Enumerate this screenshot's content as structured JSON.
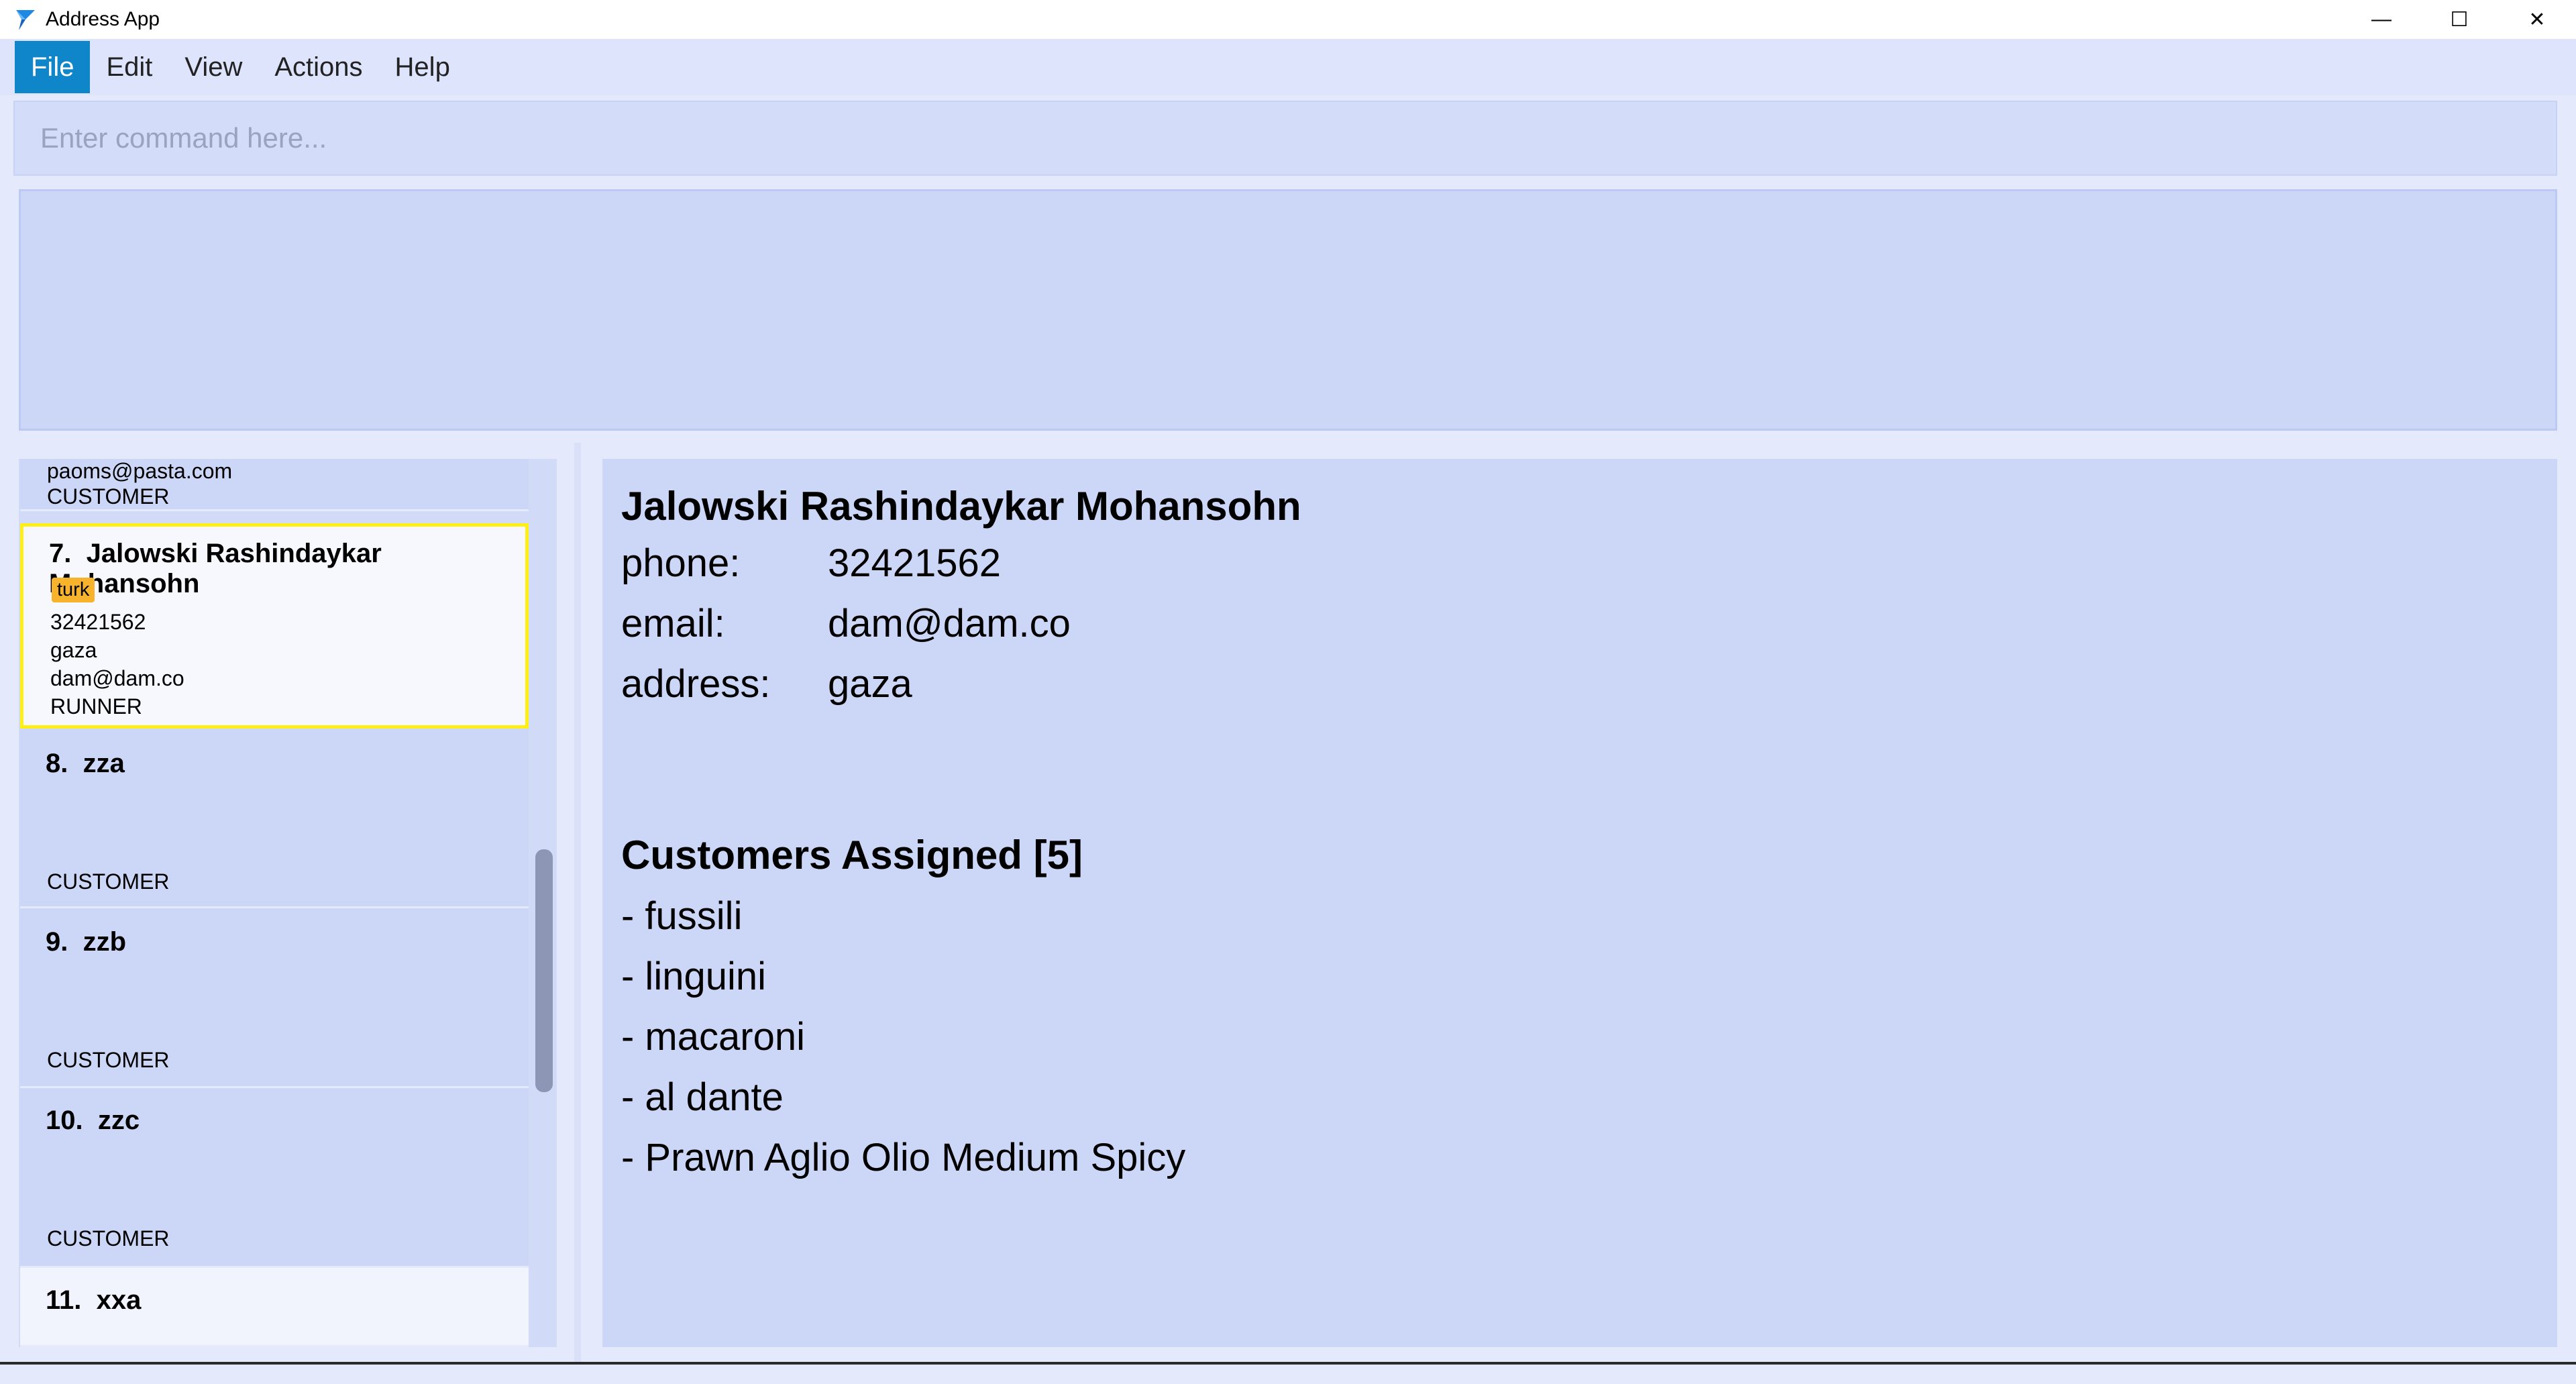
{
  "window": {
    "title": "Address App",
    "controls": {
      "minimize": "—",
      "maximize": "☐",
      "close": "✕"
    }
  },
  "menu": {
    "items": [
      "File",
      "Edit",
      "View",
      "Actions",
      "Help"
    ]
  },
  "command": {
    "placeholder": "Enter command here...",
    "value": ""
  },
  "list": {
    "partial_card": {
      "email": "paoms@pasta.com",
      "role": "CUSTOMER"
    },
    "cards": [
      {
        "index": "7.",
        "name": "Jalowski Rashindaykar Mohansohn",
        "tag": "turk",
        "phone": "32421562",
        "address": "gaza",
        "email": "dam@dam.co",
        "role": "RUNNER"
      },
      {
        "index": "8.",
        "name": "zza",
        "role": "CUSTOMER"
      },
      {
        "index": "9.",
        "name": "zzb",
        "role": "CUSTOMER"
      },
      {
        "index": "10.",
        "name": "zzc",
        "role": "CUSTOMER"
      },
      {
        "index": "11.",
        "name": "xxa"
      }
    ]
  },
  "detail": {
    "name": "Jalowski Rashindaykar Mohansohn",
    "phone_label": "phone:",
    "phone": "32421562",
    "email_label": "email:",
    "email": "dam@dam.co",
    "address_label": "address:",
    "address": "gaza",
    "customers_heading": "Customers Assigned [5]",
    "customers": [
      "- fussili",
      "- linguini",
      "- macaroni",
      "- al dante",
      "- Prawn Aglio Olio Medium Spicy"
    ]
  },
  "colors": {
    "menu_active": "#0e86c9",
    "selected_border": "#ffef14",
    "tag_bg": "#f8b32c"
  }
}
